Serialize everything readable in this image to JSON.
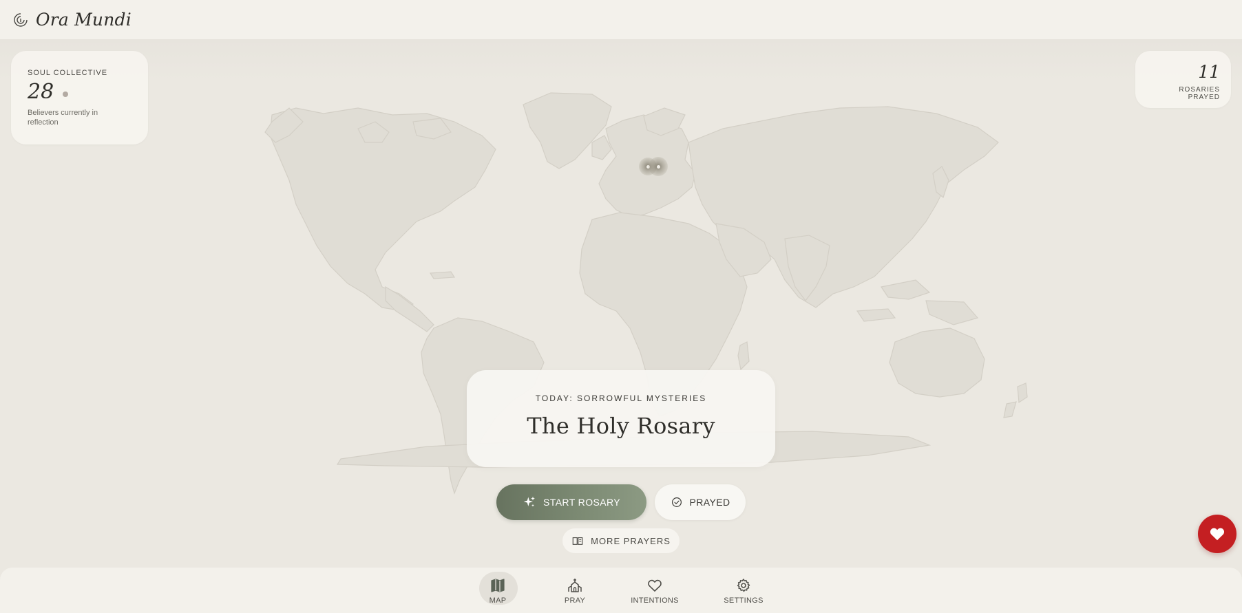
{
  "app": {
    "title": "Ora Mundi",
    "logo_icon": "spiral-icon"
  },
  "soul_collective": {
    "label": "SOUL COLLECTIVE",
    "count": "28",
    "caption": "Believers currently in reflection"
  },
  "rosaries": {
    "count": "11",
    "label": "ROSARIES PRAYED"
  },
  "mystery": {
    "label": "TODAY: SORROWFUL MYSTERIES",
    "title": "The Holy Rosary"
  },
  "actions": {
    "start_label": "START ROSARY",
    "start_icon": "sparkle-icon",
    "prayed_label": "PRAYED",
    "prayed_icon": "check-circle-icon",
    "more_label": "MORE PRAYERS",
    "more_icon": "book-open-icon"
  },
  "favorite": {
    "icon": "heart-icon",
    "color": "#c41f22"
  },
  "nav": {
    "items": [
      {
        "label": "MAP",
        "icon": "map-icon",
        "active": true
      },
      {
        "label": "PRAY",
        "icon": "church-icon",
        "active": false
      },
      {
        "label": "INTENTIONS",
        "icon": "heart-outline-icon",
        "active": false
      },
      {
        "label": "SETTINGS",
        "icon": "gear-icon",
        "active": false
      }
    ]
  },
  "colors": {
    "background": "#ebe8e1",
    "surface": "#f3f1eb",
    "accent_green": "#67735f",
    "favorite_red": "#c41f22"
  }
}
